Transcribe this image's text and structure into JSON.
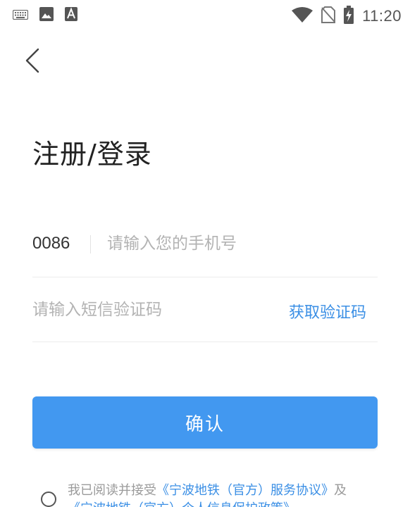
{
  "status_bar": {
    "time": "11:20",
    "left_icons": [
      "keyboard-icon",
      "image-icon",
      "a-app-icon"
    ],
    "right_icons": [
      "wifi-icon",
      "no-sim-icon",
      "battery-charging-icon"
    ]
  },
  "nav": {
    "back_icon": "chevron-left-icon"
  },
  "page": {
    "title": "注册/登录"
  },
  "form": {
    "country_code": "0086",
    "phone_placeholder": "请输入您的手机号",
    "phone_value": "",
    "code_placeholder": "请输入短信验证码",
    "code_value": "",
    "get_code_label": "获取验证码"
  },
  "confirm_button": {
    "label": "确认"
  },
  "agreement": {
    "prefix": "我已阅读并接受",
    "service_link": "《宁波地铁（官方）服务协议》",
    "and_text": "及",
    "privacy_link": "《宁波地铁（官方）个人信息保护政策》",
    "checked": false
  },
  "colors": {
    "accent": "#4298f0",
    "link": "#3b8fe5",
    "placeholder": "#b3b3b3",
    "divider": "#ececec"
  }
}
